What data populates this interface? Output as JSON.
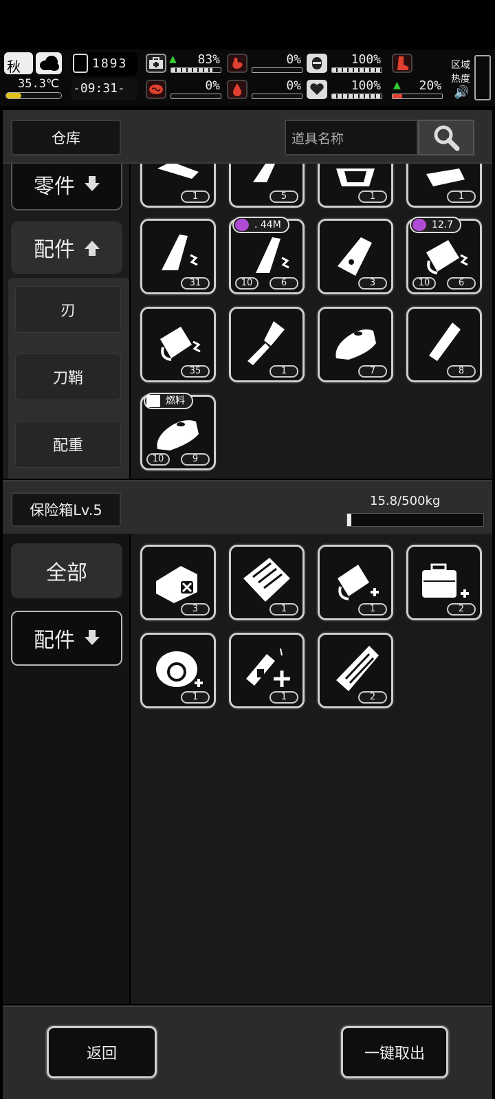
{
  "hud": {
    "season": "秋",
    "temperature": "35.3℃",
    "day": "1893",
    "time": "-09:31-",
    "stats": [
      {
        "name": "health",
        "value": "83%",
        "fill": 0.83,
        "color": "#e8e8e8"
      },
      {
        "name": "hunger",
        "value": "0%",
        "fill": 0.0,
        "color": "#e04030"
      },
      {
        "name": "shield",
        "value": "100%",
        "fill": 1.0,
        "color": "#e8e8e8"
      },
      {
        "name": "sanity",
        "value": "0%",
        "fill": 0.0,
        "color": "#e04030"
      },
      {
        "name": "thirst",
        "value": "0%",
        "fill": 0.0,
        "color": "#e04030"
      },
      {
        "name": "mood",
        "value": "100%",
        "fill": 1.0,
        "color": "#e8e8e8"
      }
    ],
    "stamina": {
      "value": "20%",
      "fill": 0.2
    },
    "region_label_1": "区域",
    "region_label_2": "热度"
  },
  "warehouse": {
    "title": "仓库",
    "search_placeholder": "道具名称",
    "categories": {
      "parts": "零件",
      "accessories": "配件",
      "blade": "刃",
      "sheath": "刀鞘",
      "counterweight": "配重"
    },
    "items": [
      {
        "count": "1"
      },
      {
        "count": "5"
      },
      {
        "count": "1"
      },
      {
        "count": "1"
      },
      {
        "count": "31"
      },
      {
        "count": "6",
        "left": "10",
        "badge": ". 44M"
      },
      {
        "count": "3"
      },
      {
        "count": "6",
        "left": "10",
        "badge": "12.7"
      },
      {
        "count": "35"
      },
      {
        "count": "1"
      },
      {
        "count": "7"
      },
      {
        "count": "8"
      },
      {
        "count": "9",
        "left": "10",
        "badge": "燃料"
      }
    ]
  },
  "safebox": {
    "title": "保险箱Lv.5",
    "capacity": "15.8/500kg",
    "capacity_fraction": 0.0316,
    "categories": {
      "all": "全部",
      "accessories": "配件"
    },
    "items": [
      {
        "count": "3"
      },
      {
        "count": "1"
      },
      {
        "count": "1"
      },
      {
        "count": "2"
      },
      {
        "count": "1"
      },
      {
        "count": "1"
      },
      {
        "count": "2"
      }
    ]
  },
  "footer": {
    "back": "返回",
    "take_all": "一键取出"
  }
}
